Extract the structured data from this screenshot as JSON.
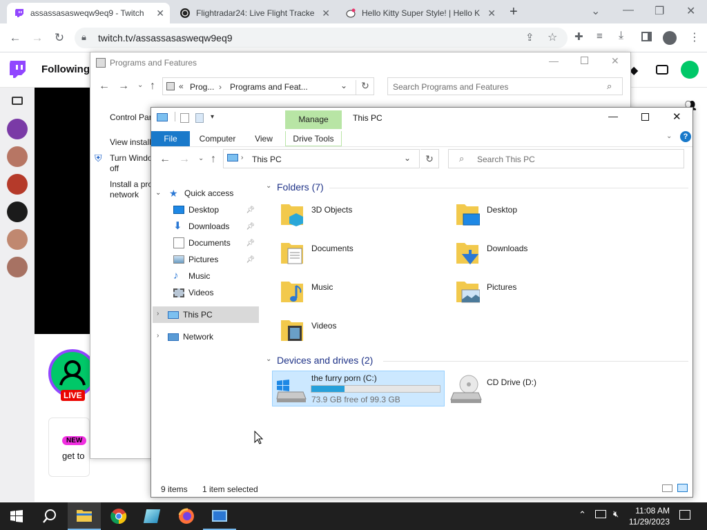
{
  "browser": {
    "tabs": [
      {
        "title": "assassasasweqw9eq9 - Twitch"
      },
      {
        "title": "Flightradar24: Live Flight Tracker"
      },
      {
        "title": "Hello Kitty Super Style! | Hello Kit"
      }
    ],
    "url": "twitch.tv/assassasasweqw9eq9"
  },
  "twitch": {
    "following_label": "Following",
    "live_badge": "LIVE",
    "new_badge": "NEW",
    "promo_text": "get to"
  },
  "programs_window": {
    "title": "Programs and Features",
    "breadcrumb_prefix": "Prog...",
    "breadcrumb_current": "Programs and Feat...",
    "search_placeholder": "Search Programs and Features",
    "links": [
      {
        "label": "Control Par"
      },
      {
        "label": "View install"
      },
      {
        "label": "Turn Windo"
      },
      {
        "label": "off"
      },
      {
        "label": "Install a pro"
      },
      {
        "label": "network"
      }
    ]
  },
  "explorer": {
    "window_title": "This PC",
    "manage_label": "Manage",
    "ribbon_tabs": [
      "File",
      "Computer",
      "View",
      "Drive Tools"
    ],
    "address": "This PC",
    "search_placeholder": "Search This PC",
    "nav": {
      "quick_access": "Quick access",
      "items": [
        "Desktop",
        "Downloads",
        "Documents",
        "Pictures",
        "Music",
        "Videos"
      ],
      "this_pc": "This PC",
      "network": "Network"
    },
    "folders_header": "Folders (7)",
    "folders": [
      "3D Objects",
      "Desktop",
      "Documents",
      "Downloads",
      "Music",
      "Pictures",
      "Videos"
    ],
    "devices_header": "Devices and drives (2)",
    "drives": [
      {
        "name": "the furry porn (C:)",
        "free": "73.9 GB free of 99.3 GB",
        "used_fraction": 0.256
      },
      {
        "name": "CD Drive (D:)"
      }
    ],
    "status_items": "9 items",
    "status_selected": "1 item selected"
  },
  "taskbar": {
    "time": "11:08 AM",
    "date": "11/29/2023"
  },
  "colors": {
    "twitch_purple": "#9146ff",
    "manage_green": "#b8e5a5",
    "file_tab_blue": "#1979ca",
    "selection_blue": "#cce8ff"
  }
}
